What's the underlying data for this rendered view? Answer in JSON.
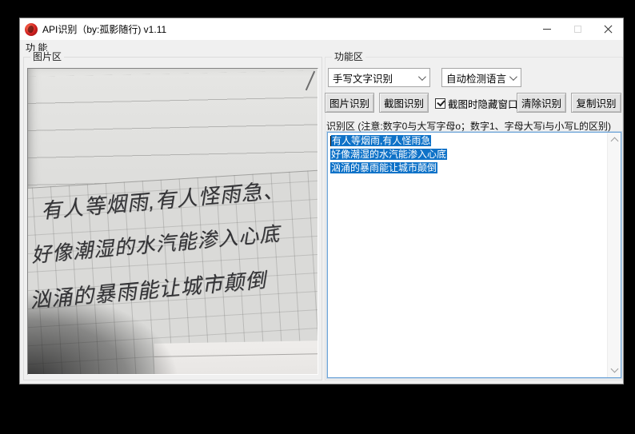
{
  "window": {
    "title": "API识别（by:孤影随行) v1.11",
    "controls": {
      "minimize_icon": "minimize-dash",
      "maximize_icon": "maximize-square-disabled",
      "close_icon": "close-x"
    }
  },
  "menu": {
    "items": [
      {
        "label": "功 能"
      }
    ]
  },
  "picture_panel": {
    "label": "图片区",
    "photo": {
      "handwriting_lines": [
        "有人等烟雨,有人怪雨急、",
        "好像潮湿的水汽能渗入心底",
        "汹涌的暴雨能让城市颠倒"
      ]
    }
  },
  "function_panel": {
    "label": "功能区",
    "mode_select": {
      "value": "手写文字识别"
    },
    "language_select": {
      "value": "自动检测语言"
    },
    "buttons": {
      "image_ocr": "图片识别",
      "screenshot_ocr": "截图识别",
      "clear": "清除识别",
      "copy": "复制识别"
    },
    "hide_window_checkbox": {
      "label": "截图时隐藏窗口",
      "checked": true
    }
  },
  "result_panel": {
    "label": "识别区 (注意:数字0与大写字母o；数字1、字母大写i与小写L的区别)",
    "lines": [
      "有人等烟雨,有人怪雨急",
      "好像潮湿的水汽能渗入心底",
      "汹涌的暴雨能让城市颠倒"
    ],
    "selection_active": true
  },
  "colors": {
    "selection": "#0e72c8",
    "textarea_focus_border": "#6da4d8",
    "titlebar_bg": "#ffffff",
    "client_bg": "#f0f0f0",
    "button_bg": "#e3e3e3"
  }
}
